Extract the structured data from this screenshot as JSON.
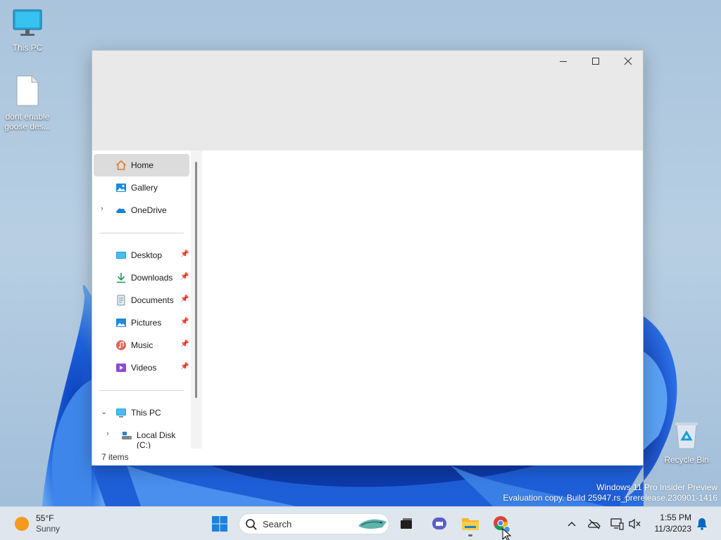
{
  "desktop": {
    "icons": [
      {
        "label": "This PC",
        "icon": "monitor-icon"
      },
      {
        "label_line1": "dont enable",
        "label_line2": "goose des...",
        "icon": "file-icon"
      },
      {
        "label": "Recycle Bin",
        "icon": "recycle-bin-icon"
      }
    ],
    "watermark": {
      "line1": "Windows 11 Pro Insider Preview",
      "line2": "Evaluation copy. Build 25947.rs_prerelease.230901-1416"
    }
  },
  "window": {
    "controls": {
      "minimize": "—",
      "maximize": "☐",
      "close": "✕"
    },
    "nav": {
      "quick": [
        {
          "label": "Home",
          "icon": "home-icon",
          "selected": true
        },
        {
          "label": "Gallery",
          "icon": "gallery-icon"
        },
        {
          "label": "OneDrive",
          "icon": "onedrive-icon",
          "expandable": true
        }
      ],
      "pinned": [
        {
          "label": "Desktop",
          "icon": "desktop-folder-icon"
        },
        {
          "label": "Downloads",
          "icon": "downloads-icon"
        },
        {
          "label": "Documents",
          "icon": "documents-icon"
        },
        {
          "label": "Pictures",
          "icon": "pictures-icon"
        },
        {
          "label": "Music",
          "icon": "music-icon"
        },
        {
          "label": "Videos",
          "icon": "videos-icon"
        }
      ],
      "this_pc": {
        "label": "This PC",
        "icon": "this-pc-icon"
      },
      "local_disk": {
        "label": "Local Disk (C:)",
        "icon": "drive-icon"
      }
    },
    "status": {
      "items": "7 items"
    }
  },
  "taskbar": {
    "weather": {
      "temp": "55°F",
      "condition": "Sunny",
      "icon": "sun-icon"
    },
    "search": {
      "placeholder": "Search"
    },
    "apps": [
      "start-icon",
      "search-icon",
      "task-view-icon",
      "teams-chat-icon",
      "file-explorer-icon",
      "chrome-icon"
    ],
    "clock": {
      "time": "1:55 PM",
      "date": "11/3/2023"
    },
    "colors": {
      "accent": "#0067c0"
    }
  }
}
